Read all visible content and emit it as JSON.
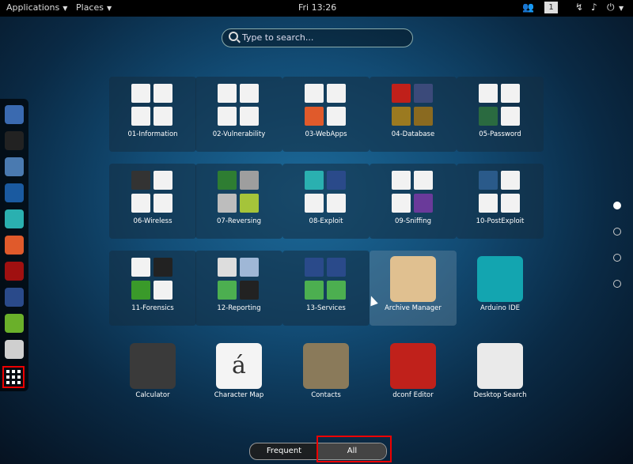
{
  "topbar": {
    "applications": "Applications",
    "places": "Places",
    "clock": "Fri 13:26",
    "workspace": "1"
  },
  "search": {
    "placeholder": "Type to search..."
  },
  "pages": {
    "count": 4,
    "active": 0
  },
  "view_switcher": {
    "frequent": "Frequent",
    "all": "All"
  },
  "apps": [
    {
      "label": "01-Information",
      "kind": "folder",
      "colors": [
        "#f2f2f2",
        "#f2f2f2",
        "#f2f2f2",
        "#f2f2f2"
      ]
    },
    {
      "label": "02-Vulnerability",
      "kind": "folder",
      "colors": [
        "#f2f2f2",
        "#f2f2f2",
        "#f2f2f2",
        "#f2f2f2"
      ]
    },
    {
      "label": "03-WebApps",
      "kind": "folder",
      "colors": [
        "#f2f2f2",
        "#f2f2f2",
        "#e05a2b",
        "#f2f2f2"
      ]
    },
    {
      "label": "04-Database",
      "kind": "folder",
      "colors": [
        "#c0201a",
        "#3b4a7a",
        "#9b7a20",
        "#8a6a20"
      ]
    },
    {
      "label": "05-Password",
      "kind": "folder",
      "colors": [
        "#f2f2f2",
        "#f2f2f2",
        "#2a6a40",
        "#f2f2f2"
      ]
    },
    {
      "label": "06-Wireless",
      "kind": "folder",
      "colors": [
        "#333333",
        "#f2f2f2",
        "#f2f2f2",
        "#f2f2f2"
      ]
    },
    {
      "label": "07-Reversing",
      "kind": "folder",
      "colors": [
        "#2e7d32",
        "#9e9e9e",
        "#bdbdbd",
        "#a5c43a"
      ]
    },
    {
      "label": "08-Exploit",
      "kind": "folder",
      "colors": [
        "#2ab0b0",
        "#2a4a8a",
        "#f2f2f2",
        "#f2f2f2"
      ]
    },
    {
      "label": "09-Sniffing",
      "kind": "folder",
      "colors": [
        "#f2f2f2",
        "#f2f2f2",
        "#f2f2f2",
        "#6a3a9a"
      ]
    },
    {
      "label": "10-PostExploit",
      "kind": "folder",
      "colors": [
        "#2a5a8a",
        "#f2f2f2",
        "#f2f2f2",
        "#f2f2f2"
      ]
    },
    {
      "label": "11-Forensics",
      "kind": "folder",
      "colors": [
        "#f2f2f2",
        "#222222",
        "#3a9a2a",
        "#f2f2f2"
      ]
    },
    {
      "label": "12-Reporting",
      "kind": "folder",
      "colors": [
        "#dddddd",
        "#9fb7d6",
        "#4caf50",
        "#222222"
      ]
    },
    {
      "label": "13-Services",
      "kind": "folder",
      "colors": [
        "#2a4a8a",
        "#2a4a8a",
        "#4caf50",
        "#4caf50"
      ]
    },
    {
      "label": "Archive Manager",
      "kind": "app",
      "color": "#e0c090",
      "hover": true
    },
    {
      "label": "Arduino IDE",
      "kind": "app",
      "color": "#13a5b0"
    },
    {
      "label": "Calculator",
      "kind": "app",
      "color": "#3a3a3a"
    },
    {
      "label": "Character Map",
      "kind": "app",
      "color": "#f4f4f4",
      "glyph": "á"
    },
    {
      "label": "Contacts",
      "kind": "app",
      "color": "#8a7a5a"
    },
    {
      "label": "dconf Editor",
      "kind": "app",
      "color": "#c0211b"
    },
    {
      "label": "Desktop Search",
      "kind": "app",
      "color": "#eaeaea"
    }
  ],
  "dash": [
    {
      "name": "iceweasel-icon",
      "color": "#3a6ab0"
    },
    {
      "name": "terminal-icon",
      "color": "#222222"
    },
    {
      "name": "files-icon",
      "color": "#4a7ab0"
    },
    {
      "name": "metasploit-icon",
      "color": "#1a5aa0"
    },
    {
      "name": "armitage-icon",
      "color": "#2ab0b0"
    },
    {
      "name": "burpsuite-icon",
      "color": "#e05a2b"
    },
    {
      "name": "faraday-icon",
      "color": "#a01010"
    },
    {
      "name": "maltego-icon",
      "color": "#2a4a8a"
    },
    {
      "name": "leafpad-icon",
      "color": "#6ab02a"
    },
    {
      "name": "cherrytree-icon",
      "color": "#cfcfcf"
    }
  ]
}
